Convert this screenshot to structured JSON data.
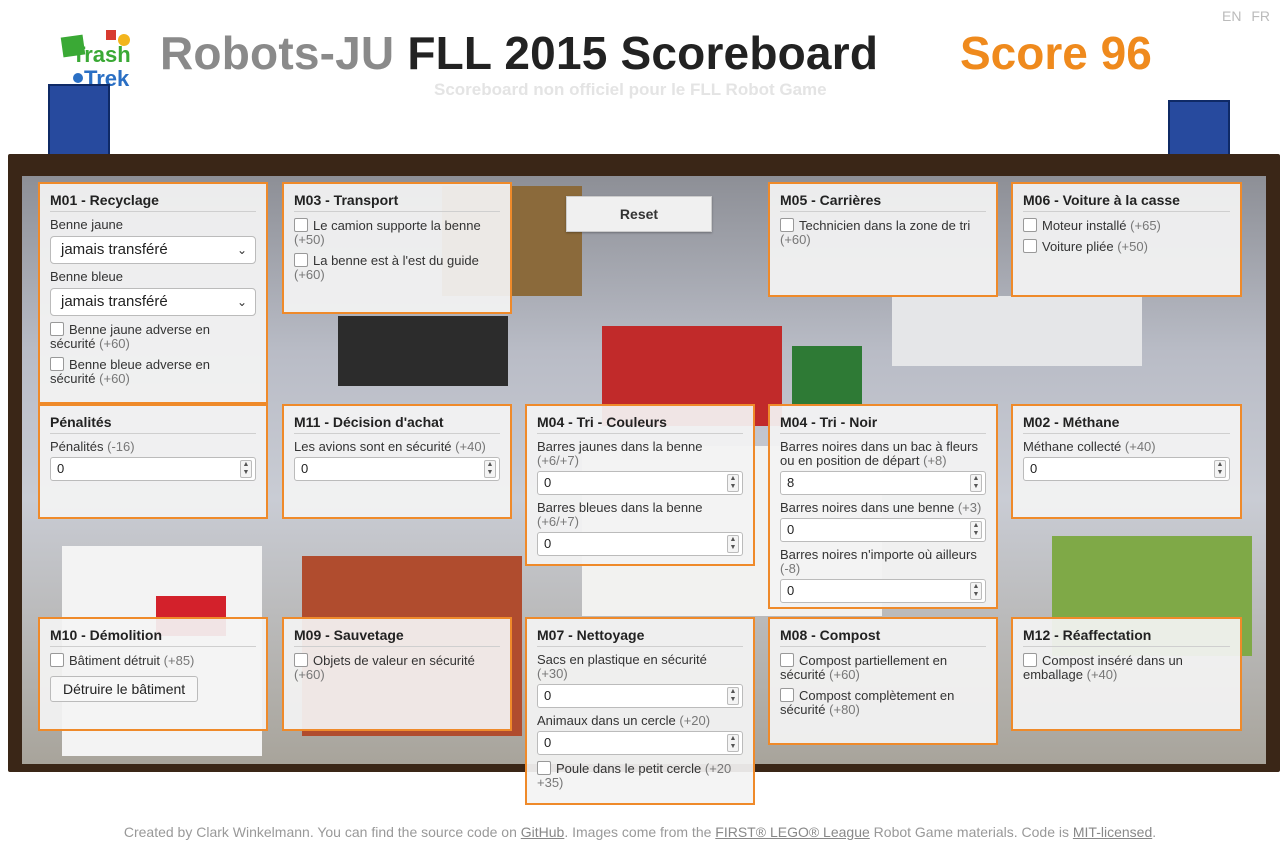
{
  "lang": {
    "en": "EN",
    "fr": "FR"
  },
  "logo": {
    "line1": "Trash",
    "line2": "Trek"
  },
  "header": {
    "title_team": "Robots-JU",
    "title_main": "FLL 2015 Scoreboard",
    "score": "Score 96",
    "subtitle": "Scoreboard non officiel pour le FLL Robot Game"
  },
  "reset_label": "Reset",
  "m01": {
    "title": "M01 - Recyclage",
    "yellow_label": "Benne jaune",
    "yellow_value": "jamais transféré",
    "blue_label": "Benne bleue",
    "blue_value": "jamais transféré",
    "opp_yellow": "Benne jaune adverse en sécurité",
    "opp_yellow_pts": "(+60)",
    "opp_blue": "Benne bleue adverse en sécurité",
    "opp_blue_pts": "(+60)"
  },
  "m03": {
    "title": "M03 - Transport",
    "truck": "Le camion supporte la benne",
    "truck_pts": "(+50)",
    "east": "La benne est à l'est du guide",
    "east_pts": "(+60)"
  },
  "m05": {
    "title": "M05 - Carrières",
    "tech": "Technicien dans la zone de tri",
    "tech_pts": "(+60)"
  },
  "m06": {
    "title": "M06 - Voiture à la casse",
    "engine": "Moteur installé",
    "engine_pts": "(+65)",
    "folded": "Voiture pliée",
    "folded_pts": "(+50)"
  },
  "penalties": {
    "title": "Pénalités",
    "label": "Pénalités",
    "pts": "(-16)",
    "value": "0"
  },
  "m11": {
    "title": "M11 - Décision d'achat",
    "label": "Les avions sont en sécurité",
    "pts": "(+40)",
    "value": "0"
  },
  "m04c": {
    "title": "M04 - Tri - Couleurs",
    "yellow": "Barres jaunes dans la benne",
    "yellow_pts": "(+6/+7)",
    "yellow_value": "0",
    "blue": "Barres bleues dans la benne",
    "blue_pts": "(+6/+7)",
    "blue_value": "0"
  },
  "m04n": {
    "title": "M04 - Tri - Noir",
    "flower": "Barres noires dans un bac à fleurs ou en position de départ",
    "flower_pts": "(+8)",
    "flower_value": "8",
    "bin": "Barres noires dans une benne",
    "bin_pts": "(+3)",
    "bin_value": "0",
    "else": "Barres noires n'importe où ailleurs",
    "else_pts": "(-8)",
    "else_value": "0"
  },
  "m02": {
    "title": "M02 - Méthane",
    "label": "Méthane collecté",
    "pts": "(+40)",
    "value": "0"
  },
  "m10": {
    "title": "M10 - Démolition",
    "label": "Bâtiment détruit",
    "pts": "(+85)",
    "button": "Détruire le bâtiment"
  },
  "m09": {
    "title": "M09 - Sauvetage",
    "label": "Objets de valeur en sécurité",
    "pts": "(+60)"
  },
  "m07": {
    "title": "M07 - Nettoyage",
    "bags": "Sacs en plastique en sécurité",
    "bags_pts": "(+30)",
    "bags_value": "0",
    "animals": "Animaux dans un cercle",
    "animals_pts": "(+20)",
    "animals_value": "0",
    "chicken": "Poule dans le petit cercle",
    "chicken_pts": "(+20 +35)"
  },
  "m08": {
    "title": "M08 - Compost",
    "partial": "Compost partiellement en sécurité",
    "partial_pts": "(+60)",
    "full": "Compost complètement en sécurité",
    "full_pts": "(+80)"
  },
  "m12": {
    "title": "M12 - Réaffectation",
    "label": "Compost inséré dans un emballage",
    "pts": "(+40)"
  },
  "footer": {
    "t1": "Created by Clark Winkelmann. You can find the source code on ",
    "l1": "GitHub",
    "t2": ". Images come from the ",
    "l2": "FIRST® LEGO® League",
    "t3": " Robot Game materials. Code is ",
    "l3": "MIT-licensed",
    "t4": "."
  }
}
